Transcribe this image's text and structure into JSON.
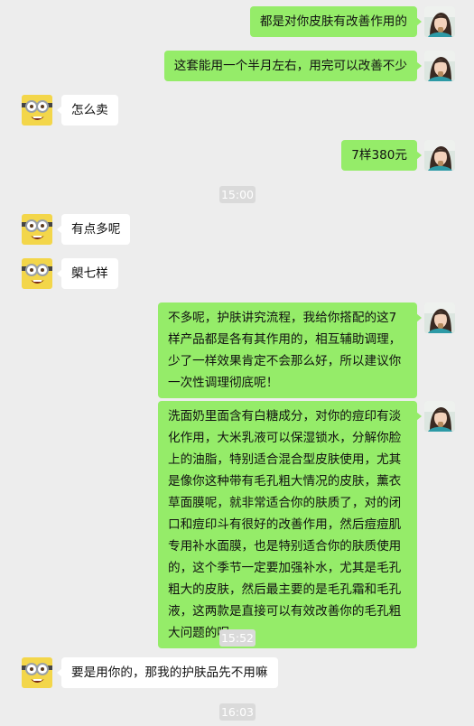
{
  "messages": [
    {
      "side": "right",
      "avatar": "woman-avatar",
      "text": "都是对你皮肤有改善作用的"
    },
    {
      "side": "right",
      "avatar": "woman-avatar",
      "text": "这套能用一个半月左右，用完可以改善不少"
    },
    {
      "side": "left",
      "avatar": "minion-avatar",
      "text": "怎么卖"
    },
    {
      "side": "right",
      "avatar": "woman-avatar",
      "text": "7样380元"
    },
    {
      "type": "time",
      "text": "15:00"
    },
    {
      "side": "left",
      "avatar": "minion-avatar",
      "text": "有点多呢"
    },
    {
      "side": "left",
      "avatar": "minion-avatar",
      "text": "㮾七样"
    },
    {
      "side": "right",
      "avatar": "woman-avatar",
      "text": "不多呢，护肤讲究流程，我给你搭配的这7样产品都是各有其作用的，相互辅助调理，少了一样效果肯定不会那么好，所以建议你一次性调理彻底呢！"
    },
    {
      "side": "right",
      "avatar": "woman-avatar",
      "text": "洗面奶里面含有白糖成分，对你的痘印有淡化作用，大米乳液可以保湿锁水，分解你脸上的油脂，特别适合混合型皮肤使用，尤其是像你这种带有毛孔粗大情况的皮肤，薰衣草面膜呢，就非常适合你的肤质了，对的闭口和痘印斗有很好的改善作用，然后痘痘肌专用补水面膜，也是特别适合你的肤质使用的，这个季节一定要加强补水，尤其是毛孔粗大的皮肤，然后最主要的是毛孔霜和毛孔液，这两款是直接可以有效改善你的毛孔粗大问题的呢"
    },
    {
      "type": "time",
      "text": "15:52"
    },
    {
      "side": "left",
      "avatar": "minion-avatar",
      "text": "要是用你的，那我的护肤品先不用嘛"
    },
    {
      "type": "time",
      "text": "16:03"
    }
  ],
  "colors": {
    "background": "#ededed",
    "sent_bubble": "#95ec69",
    "received_bubble": "#ffffff",
    "time_badge": "#dadada"
  }
}
